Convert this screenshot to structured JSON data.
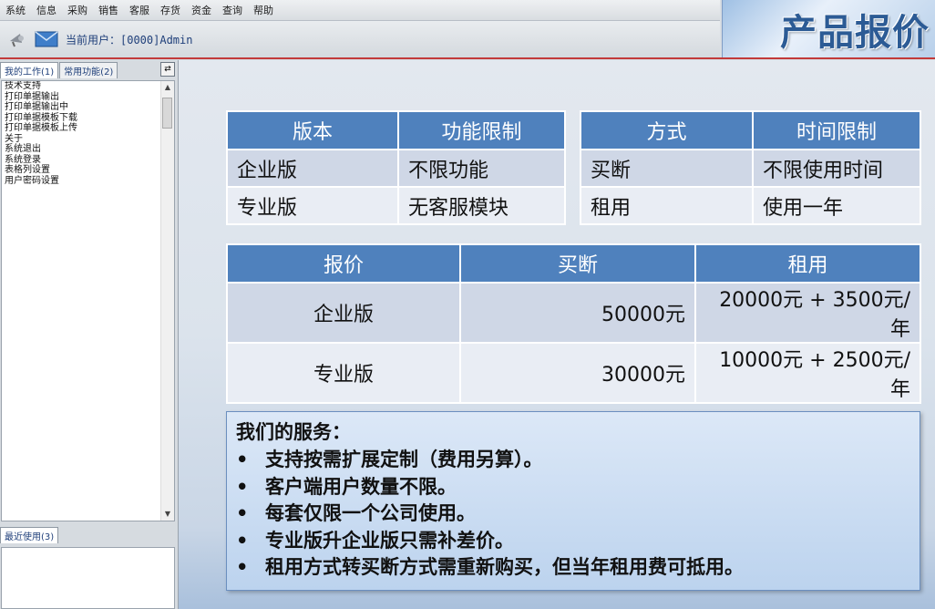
{
  "menu": [
    "系统",
    "信息",
    "采购",
    "销售",
    "客服",
    "存货",
    "资金",
    "查询",
    "帮助"
  ],
  "toolbar": {
    "user_label": "当前用户：[0000]Admin"
  },
  "banner": {
    "title": "产品报价"
  },
  "left_panel": {
    "tabs": [
      "我的工作(1)",
      "常用功能(2)"
    ],
    "items": [
      "技术支持",
      "打印单据输出",
      "打印单据输出中",
      "打印单据模板下载",
      "打印单据模板上传",
      "关于",
      "系统退出",
      "系统登录",
      "表格列设置",
      "用户密码设置"
    ],
    "recent_tab": "最近使用(3)"
  },
  "table_edition": {
    "headers": [
      "版本",
      "功能限制"
    ],
    "rows": [
      [
        "企业版",
        "不限功能"
      ],
      [
        "专业版",
        "无客服模块"
      ]
    ]
  },
  "table_mode": {
    "headers": [
      "方式",
      "时间限制"
    ],
    "rows": [
      [
        "买断",
        "不限使用时间"
      ],
      [
        "租用",
        "使用一年"
      ]
    ]
  },
  "table_price": {
    "headers": [
      "报价",
      "买断",
      "租用"
    ],
    "rows": [
      [
        "企业版",
        "50000元",
        "20000元 + 3500元/年"
      ],
      [
        "专业版",
        "30000元",
        "10000元 + 2500元/年"
      ]
    ]
  },
  "services": {
    "title": "我们的服务：",
    "items": [
      "支持按需扩展定制（费用另算）。",
      "客户端用户数量不限。",
      "每套仅限一个公司使用。",
      "专业版升企业版只需补差价。",
      "租用方式转买断方式需重新购买，但当年租用费可抵用。"
    ]
  }
}
